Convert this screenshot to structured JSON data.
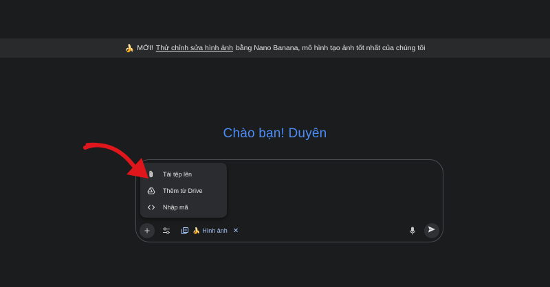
{
  "banner": {
    "emoji": "🍌",
    "prefix": "MỚI!",
    "link": "Thử chỉnh sửa hình ảnh",
    "suffix": "bằng Nano Banana, mô hình tạo ảnh tốt nhất của chúng tôi"
  },
  "greeting": "Chào bạn! Duyên",
  "upload_menu": {
    "items": [
      {
        "label": "Tải tệp lên",
        "icon": "paperclip-icon"
      },
      {
        "label": "Thêm từ Drive",
        "icon": "drive-icon"
      },
      {
        "label": "Nhập mã",
        "icon": "code-icon"
      }
    ]
  },
  "toolbar": {
    "plus_label": "+",
    "chip": {
      "emoji": "🍌",
      "label": "Hình ảnh",
      "close": "✕"
    }
  },
  "colors": {
    "background": "#1b1c1d",
    "banner": "#282a2c",
    "greeting": "#4b8df8",
    "chip": "#a8c7fa",
    "arrow": "#e0161d"
  }
}
